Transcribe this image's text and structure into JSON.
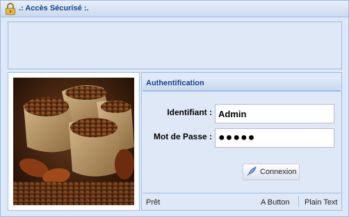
{
  "window": {
    "title": ".: Accès Sécurisé :.",
    "icon": "lock-icon"
  },
  "image": {
    "description_icon": "coffee-beans-photo"
  },
  "auth": {
    "header": "Authentification",
    "identifiant_label": "Identifiant :",
    "identifiant_value": "Admin",
    "password_label": "Mot de Passe :",
    "password_value": "●●●●●",
    "connect_label": "Connexion",
    "connect_icon": "feather-icon"
  },
  "status": {
    "text": "Prêt",
    "button_label": "A Button",
    "plain_text": "Plain Text"
  },
  "colors": {
    "border": "#99bbe8",
    "panel_bg": "#dfe8f6",
    "title_text": "#15428b"
  }
}
